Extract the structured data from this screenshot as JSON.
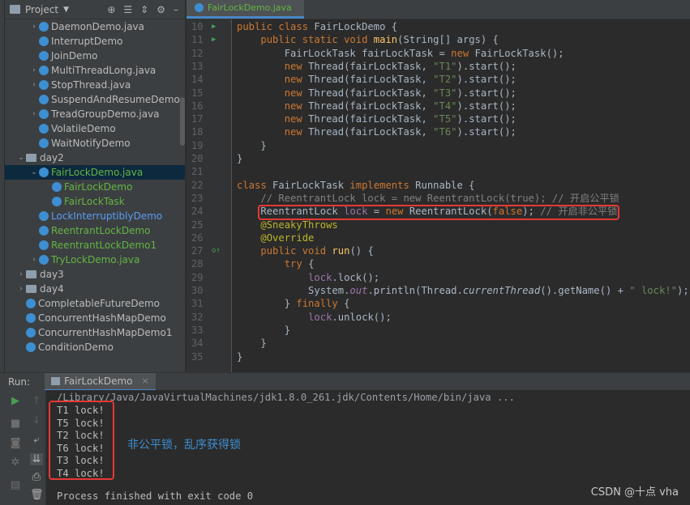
{
  "project": {
    "title": "Project",
    "tree": [
      {
        "label": "DaemonDemo.java",
        "kind": "file",
        "arrow": "›",
        "indent": 1,
        "color": "normal"
      },
      {
        "label": "InterruptDemo",
        "kind": "class",
        "arrow": "",
        "indent": 1,
        "color": "normal"
      },
      {
        "label": "JoinDemo",
        "kind": "class",
        "arrow": "",
        "indent": 1,
        "color": "normal"
      },
      {
        "label": "MultiThreadLong.java",
        "kind": "file",
        "arrow": "›",
        "indent": 1,
        "color": "normal"
      },
      {
        "label": "StopThread.java",
        "kind": "file",
        "arrow": "›",
        "indent": 1,
        "color": "normal"
      },
      {
        "label": "SuspendAndResumeDemo",
        "kind": "class",
        "arrow": "",
        "indent": 1,
        "color": "normal"
      },
      {
        "label": "TreadGroupDemo.java",
        "kind": "file",
        "arrow": "›",
        "indent": 1,
        "color": "normal"
      },
      {
        "label": "VolatileDemo",
        "kind": "class",
        "arrow": "",
        "indent": 1,
        "color": "normal"
      },
      {
        "label": "WaitNotifyDemo",
        "kind": "class",
        "arrow": "",
        "indent": 1,
        "color": "normal"
      },
      {
        "label": "day2",
        "kind": "dir",
        "arrow": "⌄",
        "indent": 0,
        "color": "normal"
      },
      {
        "label": "FairLockDemo.java",
        "kind": "file",
        "arrow": "⌄",
        "indent": 1,
        "color": "green",
        "selected": true
      },
      {
        "label": "FairLockDemo",
        "kind": "class",
        "arrow": "",
        "indent": 2,
        "color": "green"
      },
      {
        "label": "FairLockTask",
        "kind": "class",
        "arrow": "",
        "indent": 2,
        "color": "green"
      },
      {
        "label": "LockInterruptiblyDemo",
        "kind": "class",
        "arrow": "",
        "indent": 1,
        "color": "blue"
      },
      {
        "label": "ReentrantLockDemo",
        "kind": "class",
        "arrow": "",
        "indent": 1,
        "color": "green"
      },
      {
        "label": "ReentrantLockDemo1",
        "kind": "class",
        "arrow": "",
        "indent": 1,
        "color": "green"
      },
      {
        "label": "TryLockDemo.java",
        "kind": "file",
        "arrow": "›",
        "indent": 1,
        "color": "green"
      },
      {
        "label": "day3",
        "kind": "dir",
        "arrow": "›",
        "indent": 0,
        "color": "normal"
      },
      {
        "label": "day4",
        "kind": "dir",
        "arrow": "›",
        "indent": 0,
        "color": "normal"
      },
      {
        "label": "CompletableFutureDemo",
        "kind": "class",
        "arrow": "",
        "indent": 0,
        "color": "normal"
      },
      {
        "label": "ConcurrentHashMapDemo",
        "kind": "class",
        "arrow": "",
        "indent": 0,
        "color": "normal"
      },
      {
        "label": "ConcurrentHashMapDemo1",
        "kind": "class",
        "arrow": "",
        "indent": 0,
        "color": "normal"
      },
      {
        "label": "ConditionDemo",
        "kind": "class",
        "arrow": "",
        "indent": 0,
        "color": "normal"
      }
    ]
  },
  "editor": {
    "tab_label": "FairLockDemo.java",
    "lines": [
      {
        "n": "10",
        "marker": "▶",
        "html": "<span class='kw'>public class </span>FairLockDemo {"
      },
      {
        "n": "11",
        "marker": "▶",
        "html": "    <span class='kw'>public static void </span><span class='fn'>main</span>(String[] args) {"
      },
      {
        "n": "12",
        "marker": "",
        "html": "        FairLockTask fairLockTask = <span class='kw'>new </span>FairLockTask();"
      },
      {
        "n": "13",
        "marker": "",
        "html": "        <span class='kw'>new </span>Thread(fairLockTask, <span class='str'>\"T1\"</span>).start();"
      },
      {
        "n": "14",
        "marker": "",
        "html": "        <span class='kw'>new </span>Thread(fairLockTask, <span class='str'>\"T2\"</span>).start();"
      },
      {
        "n": "15",
        "marker": "",
        "html": "        <span class='kw'>new </span>Thread(fairLockTask, <span class='str'>\"T3\"</span>).start();"
      },
      {
        "n": "16",
        "marker": "",
        "html": "        <span class='kw'>new </span>Thread(fairLockTask, <span class='str'>\"T4\"</span>).start();"
      },
      {
        "n": "17",
        "marker": "",
        "html": "        <span class='kw'>new </span>Thread(fairLockTask, <span class='str'>\"T5\"</span>).start();"
      },
      {
        "n": "18",
        "marker": "",
        "html": "        <span class='kw'>new </span>Thread(fairLockTask, <span class='str'>\"T6\"</span>).start();"
      },
      {
        "n": "19",
        "marker": "",
        "html": "    }"
      },
      {
        "n": "20",
        "marker": "",
        "html": "}"
      },
      {
        "n": "21",
        "marker": "",
        "html": ""
      },
      {
        "n": "22",
        "marker": "",
        "html": "<span class='kw'>class </span>FairLockTask <span class='kw'>implements </span>Runnable {"
      },
      {
        "n": "23",
        "marker": "",
        "html": "    <span class='cmt'>// ReentrantLock lock = new ReentrantLock(true); // 开启公平锁</span>"
      },
      {
        "n": "24",
        "marker": "",
        "html": "    ReentrantLock <span class='fld'>lock </span>= <span class='kw'>new </span>ReentrantLock(<span class='kw'>false</span>); <span class='cmt'>// 开启非公平锁</span>"
      },
      {
        "n": "25",
        "marker": "",
        "html": "    <span class='ann'>@SneakyThrows</span>"
      },
      {
        "n": "26",
        "marker": "",
        "html": "    <span class='ann'>@Override</span>"
      },
      {
        "n": "27",
        "marker": "o↑",
        "html": "    <span class='kw'>public void </span><span class='fn'>run</span>() {"
      },
      {
        "n": "28",
        "marker": "",
        "html": "        <span class='kw'>try </span>{"
      },
      {
        "n": "29",
        "marker": "",
        "html": "            <span class='fld'>lock</span>.lock();"
      },
      {
        "n": "30",
        "marker": "",
        "html": "            System.<span class='fld it'>out</span>.println(Thread.<span class='it'>currentThread</span>().getName() + <span class='str'>\" lock!\"</span>);"
      },
      {
        "n": "31",
        "marker": "",
        "html": "        } <span class='kw'>finally </span>{"
      },
      {
        "n": "32",
        "marker": "",
        "html": "            <span class='fld'>lock</span>.unlock();"
      },
      {
        "n": "33",
        "marker": "",
        "html": "        }"
      },
      {
        "n": "34",
        "marker": "",
        "html": "    }"
      },
      {
        "n": "35",
        "marker": "",
        "html": "}"
      }
    ]
  },
  "run": {
    "label": "Run:",
    "tab_label": "FairLockDemo",
    "command": "/Library/Java/JavaVirtualMachines/jdk1.8.0_261.jdk/Contents/Home/bin/java ...",
    "output": [
      "T1 lock!",
      "T5 lock!",
      "T2 lock!",
      "T6 lock!",
      "T3 lock!",
      "T4 lock!"
    ],
    "finish": "Process finished with exit code 0",
    "annotation": "非公平锁，乱序获得锁"
  },
  "watermark": "CSDN @十点 vha",
  "colors": {
    "highlight_box": "#e53935",
    "annotation": "#3d8fd1",
    "keyword": "#cc7832",
    "string": "#6a8759"
  }
}
